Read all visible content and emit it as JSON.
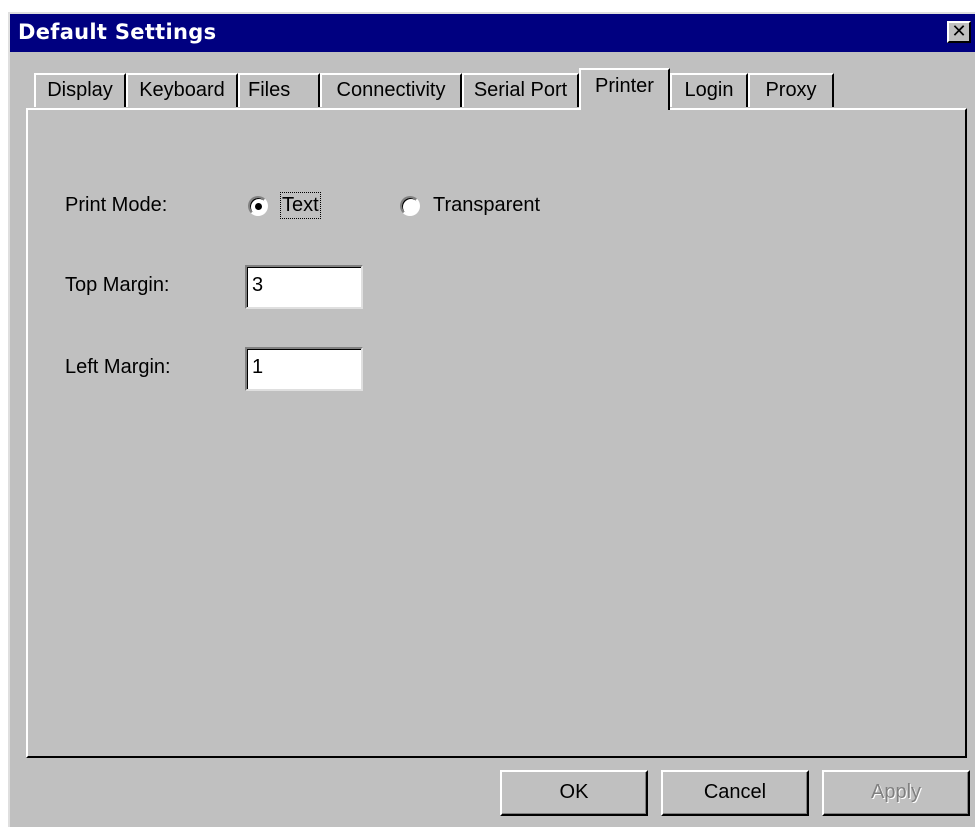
{
  "window": {
    "title": "Default Settings",
    "close_glyph": "✕"
  },
  "tabs": [
    {
      "label": "Display"
    },
    {
      "label": "Keyboard"
    },
    {
      "label": "Files"
    },
    {
      "label": "Connectivity"
    },
    {
      "label": "Serial Port"
    },
    {
      "label": "Printer",
      "active": true
    },
    {
      "label": "Login"
    },
    {
      "label": "Proxy"
    }
  ],
  "printer": {
    "print_mode_label": "Print Mode:",
    "options": [
      {
        "label": "Text",
        "selected": true
      },
      {
        "label": "Transparent",
        "selected": false
      }
    ],
    "top_margin_label": "Top Margin:",
    "top_margin_value": "3",
    "left_margin_label": "Left Margin:",
    "left_margin_value": "1"
  },
  "buttons": {
    "ok": "OK",
    "cancel": "Cancel",
    "apply": "Apply",
    "apply_enabled": false
  },
  "icons": {
    "close": "close-icon"
  }
}
